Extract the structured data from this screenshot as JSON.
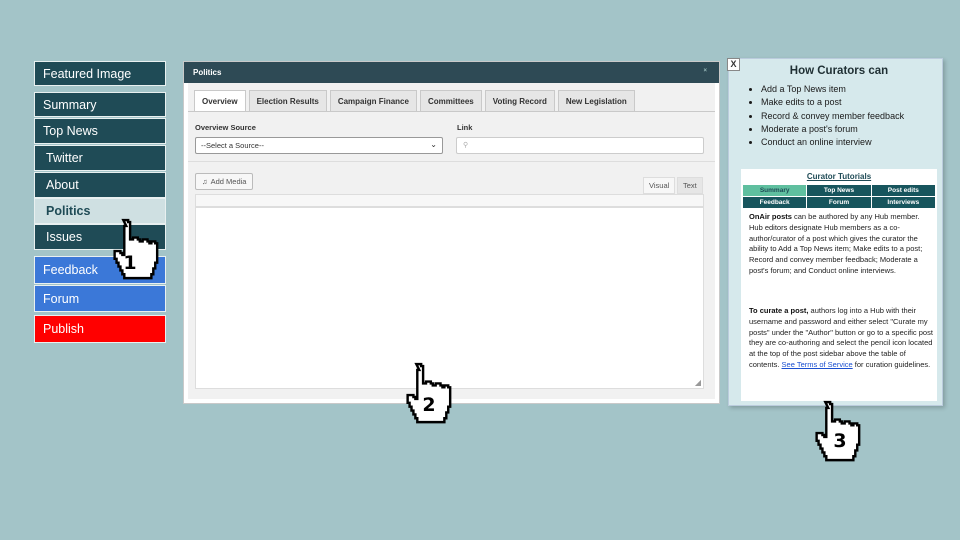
{
  "sidebar": {
    "items": [
      {
        "label": "Featured Image"
      },
      {
        "label": "Summary"
      },
      {
        "label": "Top News"
      },
      {
        "label": "Twitter"
      },
      {
        "label": "About"
      },
      {
        "label": "Politics"
      },
      {
        "label": "Issues"
      },
      {
        "label": "Feedback"
      },
      {
        "label": "Forum"
      },
      {
        "label": "Publish"
      }
    ]
  },
  "editor": {
    "title": "Politics",
    "close": "×",
    "tabs": [
      "Overview",
      "Election Results",
      "Campaign Finance",
      "Committees",
      "Voting Record",
      "New Legislation"
    ],
    "overview_source_label": "Overview Source",
    "select_value": "--Select a Source--",
    "link_label": "Link",
    "add_media": "Add Media",
    "visual_tab": "Visual",
    "text_tab": "Text"
  },
  "curators": {
    "close": "X",
    "title": "How Curators can",
    "bullets": [
      "Add a Top News item",
      "Make edits to a post",
      "Record & convey member feedback",
      "Moderate a post's forum",
      "Conduct an online interview"
    ],
    "tutorials_title": "Curator Tutorials",
    "tutorial_tabs": [
      "Summary",
      "Top News",
      "Post edits",
      "Feedback",
      "Forum",
      "Interviews"
    ],
    "para1_bold": "OnAir posts",
    "para1_rest": " can be authored by any Hub member. Hub editors designate Hub members as a co-author/curator of a post which gives the curator the ability to Add a Top News item; Make edits to a post; Record and convey member feedback; Moderate a post's forum; and Conduct online interviews.",
    "para2_bold": "To curate a post,",
    "para2_rest": " authors log into a Hub with their username and password and either select \"Curate my posts\" under the \"Author\" button or go to a specific post they are co-authoring and select the pencil icon located at the top of the post sidebar above the table of contents. ",
    "para2_link": "See Terms of Service",
    "para2_end": " for curation guidelines."
  },
  "pointers": [
    "1",
    "2",
    "3"
  ]
}
